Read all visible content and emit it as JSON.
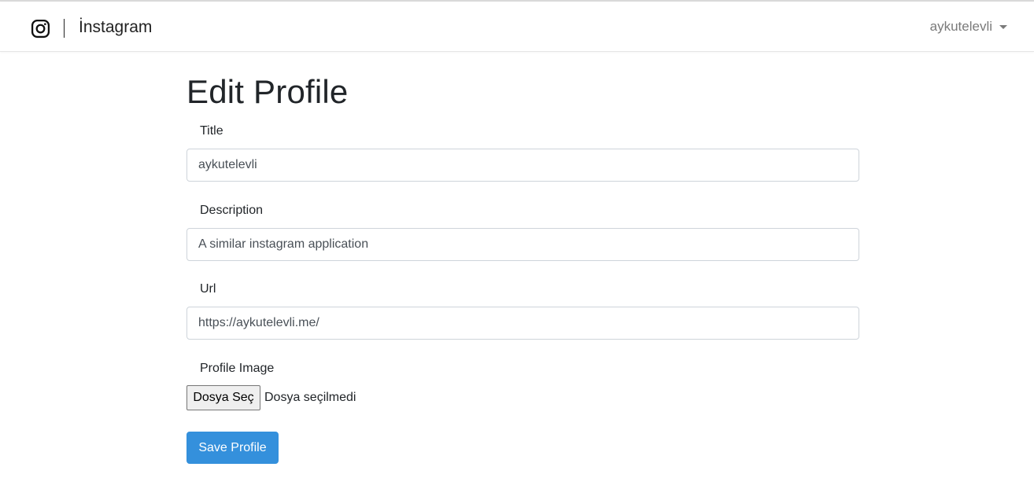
{
  "navbar": {
    "brand_icon": "instagram-icon",
    "brand_name": "İnstagram",
    "user_name": "aykutelevli",
    "dropdown_icon": "caret-down-icon"
  },
  "page": {
    "title": "Edit Profile"
  },
  "form": {
    "title_label": "Title",
    "title_value": "aykutelevli",
    "description_label": "Description",
    "description_value": "A similar instagram application",
    "url_label": "Url",
    "url_value": "https://aykutelevli.me/",
    "image_label": "Profile Image",
    "file_button_label": "Dosya Seç",
    "file_status": "Dosya seçilmedi",
    "save_label": "Save Profile"
  },
  "colors": {
    "primary": "#3490dc",
    "text": "#212529",
    "muted": "#7a7a7a",
    "input_border": "#ced4da"
  }
}
